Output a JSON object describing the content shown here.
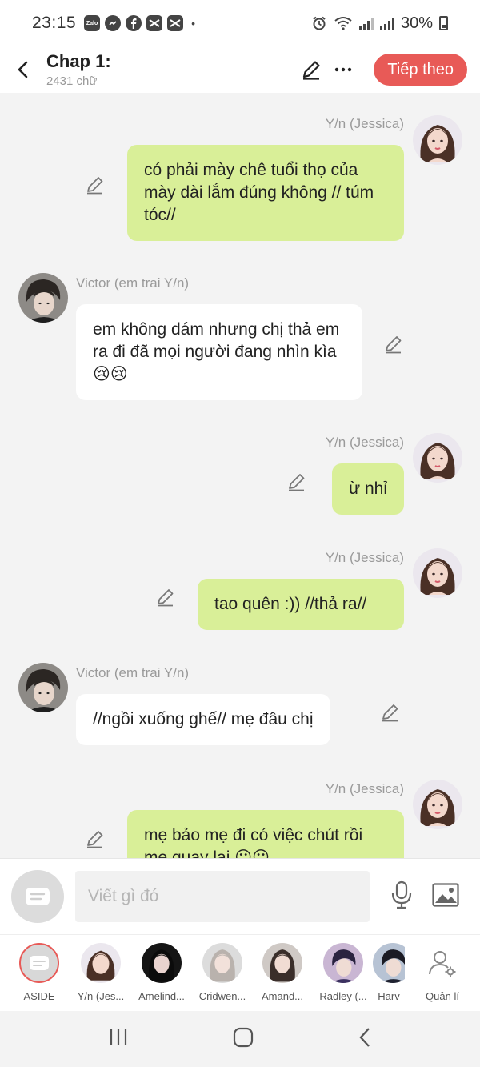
{
  "status": {
    "time": "23:15",
    "battery": "30%",
    "apps": [
      "Zalo",
      "messenger-icon",
      "facebook-icon",
      "capcut-icon",
      "capcut-icon"
    ],
    "dot": "•"
  },
  "header": {
    "title": "Chap 1:",
    "subtitle": "2431 chữ",
    "next_label": "Tiếp theo"
  },
  "messages": [
    {
      "side": "right",
      "name": "Y/n (Jessica)",
      "text": "có phải mày chê tuổi thọ của mày dài lắm đúng không // túm tóc//"
    },
    {
      "side": "left",
      "name": "Victor (em trai Y/n)",
      "text": "em không dám nhưng chị thả em ra đi đã mọi người đang nhìn kìa 😢😢"
    },
    {
      "side": "right",
      "name": "Y/n (Jessica)",
      "text": "ừ nhỉ"
    },
    {
      "side": "right",
      "name": "Y/n (Jessica)",
      "text": "tao quên :)) //thả ra//"
    },
    {
      "side": "left",
      "name": "Victor (em trai Y/n)",
      "text": "//ngồi xuống ghế// mẹ đâu chị"
    },
    {
      "side": "right",
      "name": "Y/n (Jessica)",
      "text": "mẹ bảo mẹ đi có việc chút rồi mẹ quay lại 😶😶"
    }
  ],
  "composer": {
    "placeholder": "Viết gì đó"
  },
  "characters": [
    {
      "label": "ASIDE"
    },
    {
      "label": "Y/n (Jes..."
    },
    {
      "label": "Amelind..."
    },
    {
      "label": "Cridwen..."
    },
    {
      "label": "Amand..."
    },
    {
      "label": "Radley (..."
    },
    {
      "label": "Harv"
    },
    {
      "label": "Quản lí"
    }
  ],
  "colors": {
    "accent": "#e85a57",
    "right_bubble": "#d9ef98",
    "left_bubble": "#ffffff",
    "background": "#f3f3f3"
  }
}
